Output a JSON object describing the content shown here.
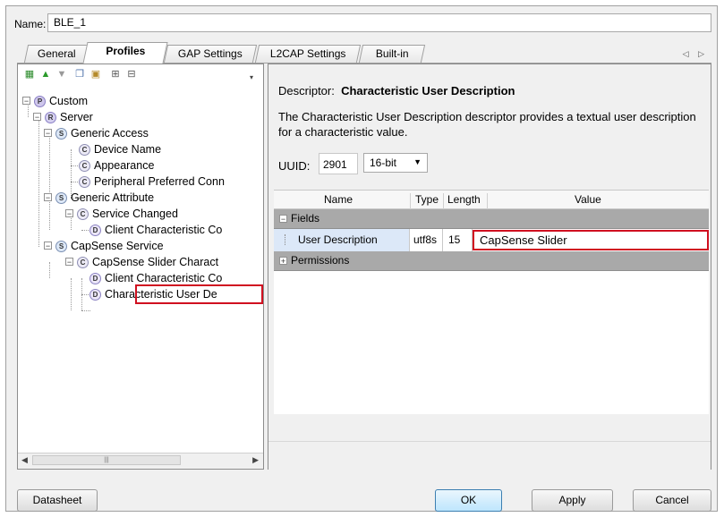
{
  "name": {
    "label": "Name:",
    "value": "BLE_1"
  },
  "tabs": [
    {
      "label": "General",
      "active": false
    },
    {
      "label": "Profiles",
      "active": true
    },
    {
      "label": "GAP Settings",
      "active": false
    },
    {
      "label": "L2CAP Settings",
      "active": false
    },
    {
      "label": "Built-in",
      "active": false
    }
  ],
  "tab_scroll": "◁ ▷",
  "toolbar_icons": [
    "add-node-icon",
    "move-up-icon",
    "move-down-icon",
    "copy-icon",
    "paste-icon",
    "expand-all-icon",
    "collapse-all-icon",
    "toolbar-dropdown-icon"
  ],
  "tree": {
    "custom": "Custom",
    "server": "Server",
    "generic_access": "Generic Access",
    "device_name": "Device Name",
    "appearance": "Appearance",
    "peripheral_pref": "Peripheral Preferred Conn",
    "generic_attribute": "Generic Attribute",
    "service_changed": "Service Changed",
    "client_char_config_1": "Client Characteristic Co",
    "capsense_service": "CapSense Service",
    "capsense_slider_char": "CapSense Slider Charact",
    "client_char_config_2": "Client Characteristic Co",
    "char_user_desc": "Characteristic User De",
    "badges": {
      "profile": "P",
      "server": "R",
      "service": "S",
      "characteristic": "C",
      "descriptor": "D"
    }
  },
  "descriptor": {
    "label": "Descriptor:",
    "title": "Characteristic User Description",
    "description": "The Characteristic User Description descriptor provides a textual user description for a characteristic value.",
    "uuid_label": "UUID:",
    "uuid_value": "2901",
    "uuid_format": "16-bit"
  },
  "grid": {
    "columns": [
      "Name",
      "Type",
      "Length",
      "Value"
    ],
    "fields_label": "Fields",
    "row": {
      "name": "User Description",
      "type": "utf8s",
      "length": "15",
      "value": "CapSense Slider"
    },
    "permissions_label": "Permissions"
  },
  "buttons": {
    "datasheet": "Datasheet",
    "ok": "OK",
    "apply": "Apply",
    "cancel": "Cancel"
  },
  "colors": {
    "highlight": "#d01020",
    "category_row": "#a9a9a9"
  }
}
